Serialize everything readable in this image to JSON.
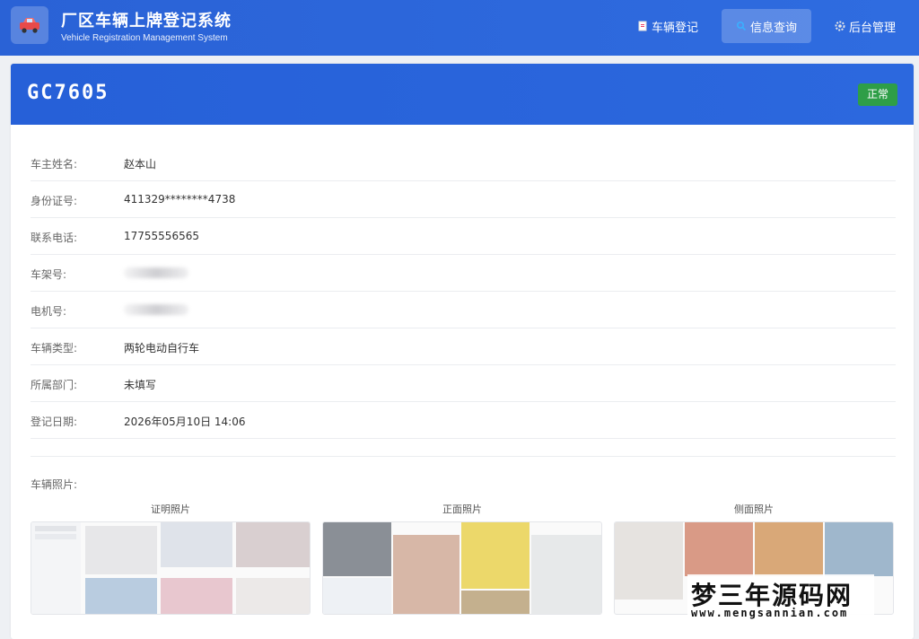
{
  "header": {
    "title": "厂区车辆上牌登记系统",
    "subtitle": "Vehicle Registration Management System",
    "logo_icon": "car-icon",
    "nav": [
      {
        "label": "车辆登记",
        "icon": "document-icon",
        "active": false
      },
      {
        "label": "信息查询",
        "icon": "search-icon",
        "active": true
      },
      {
        "label": "后台管理",
        "icon": "gear-icon",
        "active": false
      }
    ]
  },
  "vehicle": {
    "plate": "GC7605",
    "status": "正常",
    "status_color": "#2e9e47"
  },
  "fields": [
    {
      "label": "车主姓名:",
      "value": "赵本山"
    },
    {
      "label": "身份证号:",
      "value": "411329********4738"
    },
    {
      "label": "联系电话:",
      "value": "17755556565"
    },
    {
      "label": "车架号:",
      "value": ""
    },
    {
      "label": "电机号:",
      "value": ""
    },
    {
      "label": "车辆类型:",
      "value": "两轮电动自行车"
    },
    {
      "label": "所属部门:",
      "value": "未填写"
    },
    {
      "label": "登记日期:",
      "value": "2026年05月10日 14:06"
    }
  ],
  "photos": {
    "label": "车辆照片:",
    "columns": [
      {
        "title": "证明照片"
      },
      {
        "title": "正面照片"
      },
      {
        "title": "侧面照片"
      }
    ]
  },
  "watermark": {
    "text": "梦三年源码网",
    "url": "www.mengsannian.com"
  }
}
